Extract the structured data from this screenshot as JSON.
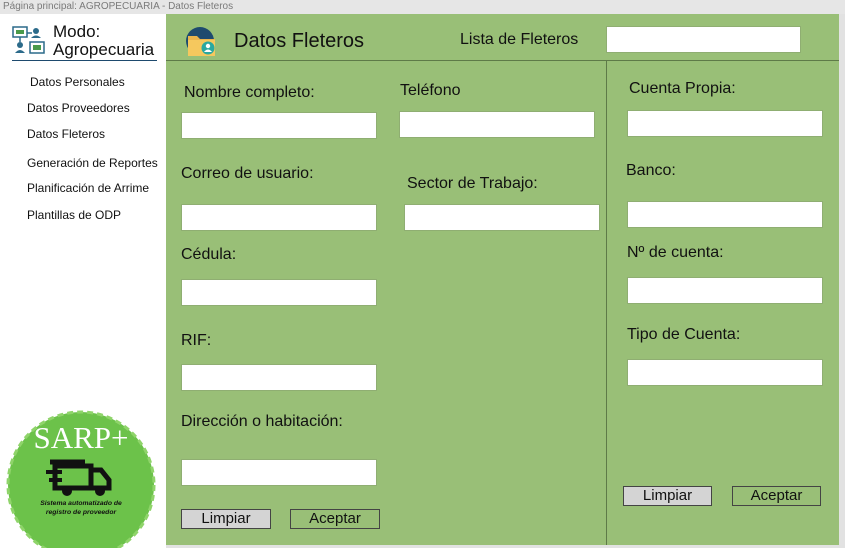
{
  "window": {
    "title": "Página principal: AGROPECUARIA - Datos Fleteros"
  },
  "sidebar": {
    "mode_label": "Modo: Agropecuaria",
    "mode_line1": "Modo:",
    "mode_line2": "Agropecuaria",
    "mode_icon": "network-users-icon",
    "items": [
      {
        "label": "Datos Personales"
      },
      {
        "label": "Datos Proveedores"
      },
      {
        "label": "Datos Fleteros"
      },
      {
        "label": "Generación de Reportes"
      },
      {
        "label": "Planificación de Arrime"
      },
      {
        "label": "Plantillas de ODP"
      }
    ],
    "logo": {
      "brand": "SARP+",
      "tagline_line1": "Sistema automatizado de",
      "tagline_line2": "registro de proveedor",
      "icon": "delivery-truck-icon",
      "color": "#6cc24a"
    }
  },
  "header": {
    "icon": "folder-user-icon",
    "title": "Datos Fleteros",
    "list_label": "Lista de Fleteros",
    "list_value": ""
  },
  "form": {
    "nombre": {
      "label": "Nombre completo:",
      "value": ""
    },
    "telefono": {
      "label": "Teléfono",
      "value": ""
    },
    "correo": {
      "label": "Correo de usuario:",
      "value": ""
    },
    "sector": {
      "label": "Sector de Trabajo:",
      "value": ""
    },
    "cedula": {
      "label": "Cédula:",
      "value": ""
    },
    "rif": {
      "label": "RIF:",
      "value": ""
    },
    "direccion": {
      "label": "Dirección o habitación:",
      "value": ""
    },
    "limpiar": "Limpiar",
    "aceptar": "Aceptar"
  },
  "bank": {
    "cuenta_propia": {
      "label": "Cuenta Propia:",
      "value": ""
    },
    "banco": {
      "label": "Banco:",
      "value": ""
    },
    "numero": {
      "label": "Nº de cuenta:",
      "value": ""
    },
    "tipo": {
      "label": "Tipo de Cuenta:",
      "value": ""
    },
    "limpiar": "Limpiar",
    "aceptar": "Aceptar"
  },
  "colors": {
    "panel": "#99bf77",
    "sidebar": "#ffffff",
    "button_gray": "#d4d4d4"
  }
}
